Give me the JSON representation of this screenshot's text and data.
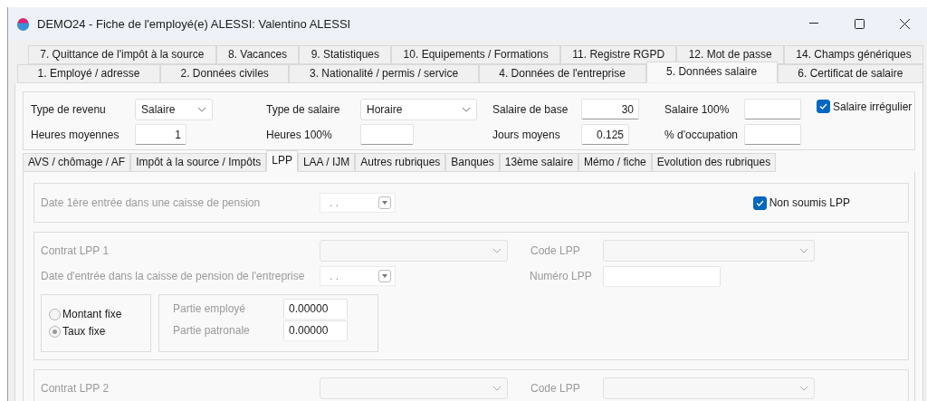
{
  "window": {
    "title": "DEMO24 - Fiche de l'employé(e) ALESSI:  Valentino ALESSI"
  },
  "tab_rows": [
    [
      {
        "label": "7. Quittance de l'impôt à la source",
        "selected": false
      },
      {
        "label": "8. Vacances",
        "selected": false
      },
      {
        "label": "9. Statistiques",
        "selected": false
      },
      {
        "label": "10. Equipements / Formations",
        "selected": false
      },
      {
        "label": "11. Registre RGPD",
        "selected": false
      },
      {
        "label": "12. Mot de passe",
        "selected": false
      },
      {
        "label": "14. Champs génériques",
        "selected": false
      }
    ],
    [
      {
        "label": "1. Employé / adresse",
        "selected": false
      },
      {
        "label": "2. Données civiles",
        "selected": false
      },
      {
        "label": "3. Nationalité / permis / service",
        "selected": false
      },
      {
        "label": "4. Données de l'entreprise",
        "selected": false
      },
      {
        "label": "5. Données salaire",
        "selected": true
      },
      {
        "label": "6. Certificat de salaire",
        "selected": false
      }
    ]
  ],
  "header": {
    "rows": [
      [
        {
          "kind": "select",
          "label": "Type de revenu",
          "value": "Salaire"
        },
        {
          "kind": "select",
          "label": "Type de salaire",
          "value": "Horaire"
        },
        {
          "kind": "input",
          "label": "Salaire de base",
          "value": "30"
        },
        {
          "kind": "input",
          "label": "Salaire 100%"
        },
        {
          "kind": "checkbox",
          "label": "Salaire irrégulier",
          "checked": true
        }
      ],
      [
        {
          "kind": "input",
          "label": "Heures moyennes",
          "value": "1"
        },
        {
          "kind": "input",
          "label": "Heures 100%"
        },
        {
          "kind": "input",
          "label": "Jours moyens",
          "value": "0.125"
        },
        {
          "kind": "input",
          "label": "% d'occupation"
        }
      ]
    ]
  },
  "sub_tabs": [
    {
      "label": "AVS / chômage / AF",
      "selected": false
    },
    {
      "label": "Impôt à la source / Impôts",
      "selected": false
    },
    {
      "label": "LPP",
      "selected": true
    },
    {
      "label": "LAA / IJM",
      "selected": false
    },
    {
      "label": "Autres rubriques",
      "selected": false
    },
    {
      "label": "Banques",
      "selected": false
    },
    {
      "label": "13ème salaire",
      "selected": false
    },
    {
      "label": "Mémo / fiche",
      "selected": false
    },
    {
      "label": "Evolution des rubriques",
      "selected": false
    }
  ],
  "lpp": {
    "first_entry": {
      "label": "Date 1ère entrée dans une caisse de pension",
      "value": ". .",
      "disabled": true
    },
    "not_subject": {
      "label": "Non soumis LPP",
      "checked": true
    },
    "contracts": [
      {
        "label": "Contrat LPP 1",
        "code_label": "Code LPP",
        "disabled": true,
        "entry_label": "Date d'entrée dans la  caisse de pension de l'entreprise",
        "entry_value": ". .",
        "number_label": "Numéro LPP",
        "modes": [
          {
            "label": "Montant fixe",
            "selected": false
          },
          {
            "label": "Taux fixe",
            "selected": true
          }
        ],
        "parts": [
          {
            "label": "Partie employé",
            "value": "0.00000"
          },
          {
            "label": "Partie patronale",
            "value": "0.00000"
          }
        ]
      },
      {
        "label": "Contrat LPP 2",
        "code_label": "Code LPP",
        "disabled": true
      }
    ]
  }
}
